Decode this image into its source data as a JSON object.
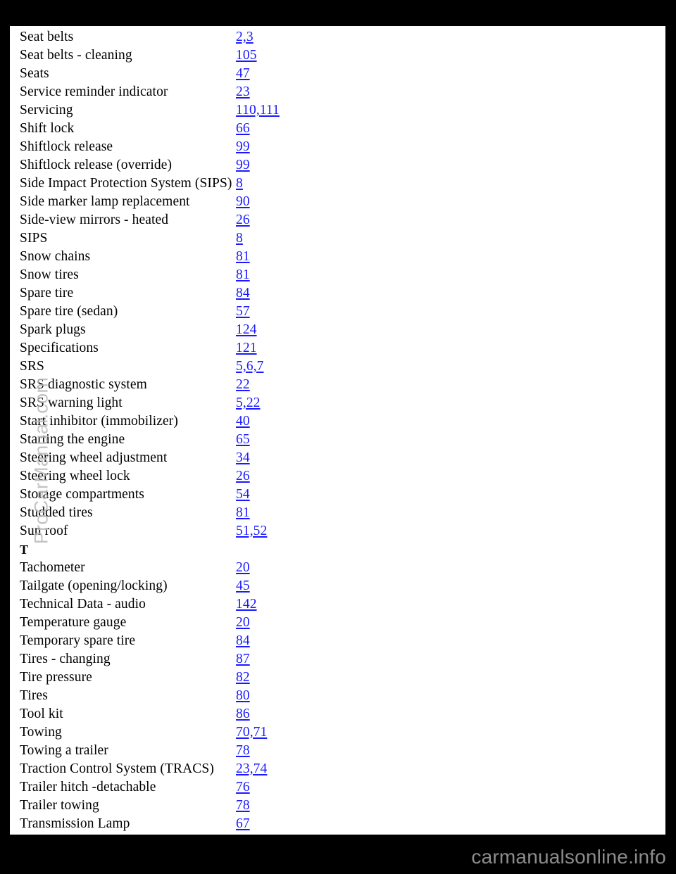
{
  "document": {
    "type": "index-page",
    "page_background": "#000000",
    "sheet_background": "#ffffff",
    "link_color": "#1a1aff",
    "text_color": "#000000"
  },
  "watermark": {
    "text": "ProCarManual.com",
    "color": "#b9b9b9"
  },
  "footer": {
    "brand": "carmanualsonline.info",
    "color": "#8c8c8c"
  },
  "index": {
    "entries": [
      {
        "term": "Seat belts",
        "pages": "2,3",
        "is_section": false
      },
      {
        "term": "Seat belts - cleaning",
        "pages": "105",
        "is_section": false
      },
      {
        "term": "Seats",
        "pages": "47",
        "is_section": false
      },
      {
        "term": "Service reminder indicator",
        "pages": "23",
        "is_section": false
      },
      {
        "term": "Servicing",
        "pages": "110,111",
        "is_section": false
      },
      {
        "term": "Shift lock",
        "pages": "66",
        "is_section": false
      },
      {
        "term": "Shiftlock release",
        "pages": "99",
        "is_section": false
      },
      {
        "term": "Shiftlock release (override)",
        "pages": "99",
        "is_section": false
      },
      {
        "term": "Side Impact Protection System (SIPS)",
        "pages": "8",
        "is_section": false
      },
      {
        "term": "Side marker lamp replacement",
        "pages": "90",
        "is_section": false
      },
      {
        "term": "Side-view mirrors - heated",
        "pages": "26",
        "is_section": false
      },
      {
        "term": "SIPS",
        "pages": "8",
        "is_section": false
      },
      {
        "term": "Snow chains",
        "pages": "81",
        "is_section": false
      },
      {
        "term": "Snow tires",
        "pages": "81",
        "is_section": false
      },
      {
        "term": "Spare tire",
        "pages": "84",
        "is_section": false
      },
      {
        "term": "Spare tire (sedan)",
        "pages": "57",
        "is_section": false
      },
      {
        "term": "Spark plugs",
        "pages": "124",
        "is_section": false
      },
      {
        "term": "Specifications",
        "pages": "121",
        "is_section": false
      },
      {
        "term": "SRS",
        "pages": "5,6,7",
        "is_section": false
      },
      {
        "term": "SRS diagnostic system",
        "pages": "22",
        "is_section": false
      },
      {
        "term": "SRS warning light",
        "pages": "5,22",
        "is_section": false
      },
      {
        "term": "Start inhibitor (immobilizer)",
        "pages": "40",
        "is_section": false
      },
      {
        "term": "Starting the engine",
        "pages": "65",
        "is_section": false
      },
      {
        "term": "Steering wheel adjustment",
        "pages": "34",
        "is_section": false
      },
      {
        "term": "Steering wheel lock",
        "pages": "26",
        "is_section": false
      },
      {
        "term": "Storage compartments",
        "pages": "54",
        "is_section": false
      },
      {
        "term": "Studded tires",
        "pages": "81",
        "is_section": false
      },
      {
        "term": "Sun roof",
        "pages": "51,52",
        "is_section": false
      },
      {
        "term": "T",
        "pages": "",
        "is_section": true
      },
      {
        "term": "Tachometer",
        "pages": "20",
        "is_section": false
      },
      {
        "term": "Tailgate (opening/locking)",
        "pages": "45",
        "is_section": false
      },
      {
        "term": "Technical Data - audio",
        "pages": "142",
        "is_section": false
      },
      {
        "term": "Temperature gauge",
        "pages": "20",
        "is_section": false
      },
      {
        "term": "Temporary spare tire",
        "pages": "84",
        "is_section": false
      },
      {
        "term": "Tires - changing",
        "pages": "87",
        "is_section": false
      },
      {
        "term": "Tire pressure",
        "pages": "82",
        "is_section": false
      },
      {
        "term": "Tires",
        "pages": "80",
        "is_section": false
      },
      {
        "term": "Tool kit",
        "pages": "86",
        "is_section": false
      },
      {
        "term": "Towing",
        "pages": "70,71",
        "is_section": false
      },
      {
        "term": "Towing a trailer",
        "pages": "78",
        "is_section": false
      },
      {
        "term": "Traction Control System (TRACS)",
        "pages": "23,74",
        "is_section": false
      },
      {
        "term": "Trailer hitch -detachable",
        "pages": "76",
        "is_section": false
      },
      {
        "term": "Trailer towing",
        "pages": "78",
        "is_section": false
      },
      {
        "term": "Transmission Lamp",
        "pages": "67",
        "is_section": false
      }
    ]
  }
}
